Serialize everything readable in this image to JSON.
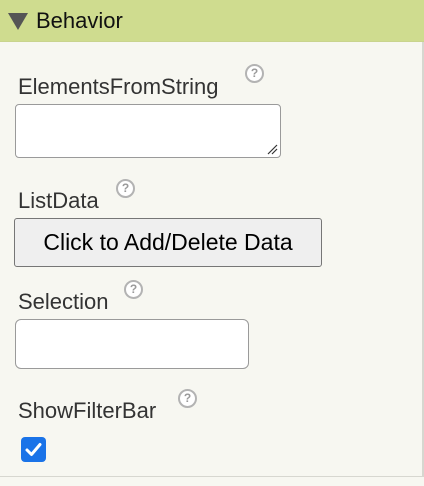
{
  "section": {
    "title": "Behavior",
    "toggle_icon": "triangle-down-icon"
  },
  "properties": {
    "elements_from_string": {
      "label": "ElementsFromString",
      "value": "",
      "help_icon": "help-question-icon"
    },
    "list_data": {
      "label": "ListData",
      "button_label": "Click to Add/Delete Data",
      "help_icon": "help-question-icon"
    },
    "selection": {
      "label": "Selection",
      "value": "",
      "help_icon": "help-question-icon"
    },
    "show_filter_bar": {
      "label": "ShowFilterBar",
      "checked": true,
      "help_icon": "help-question-icon"
    }
  },
  "help_glyph": "?",
  "colors": {
    "header_bg": "#cfdc8f",
    "panel_bg": "#f7f7f1",
    "checkbox_accent": "#1a73e8"
  }
}
